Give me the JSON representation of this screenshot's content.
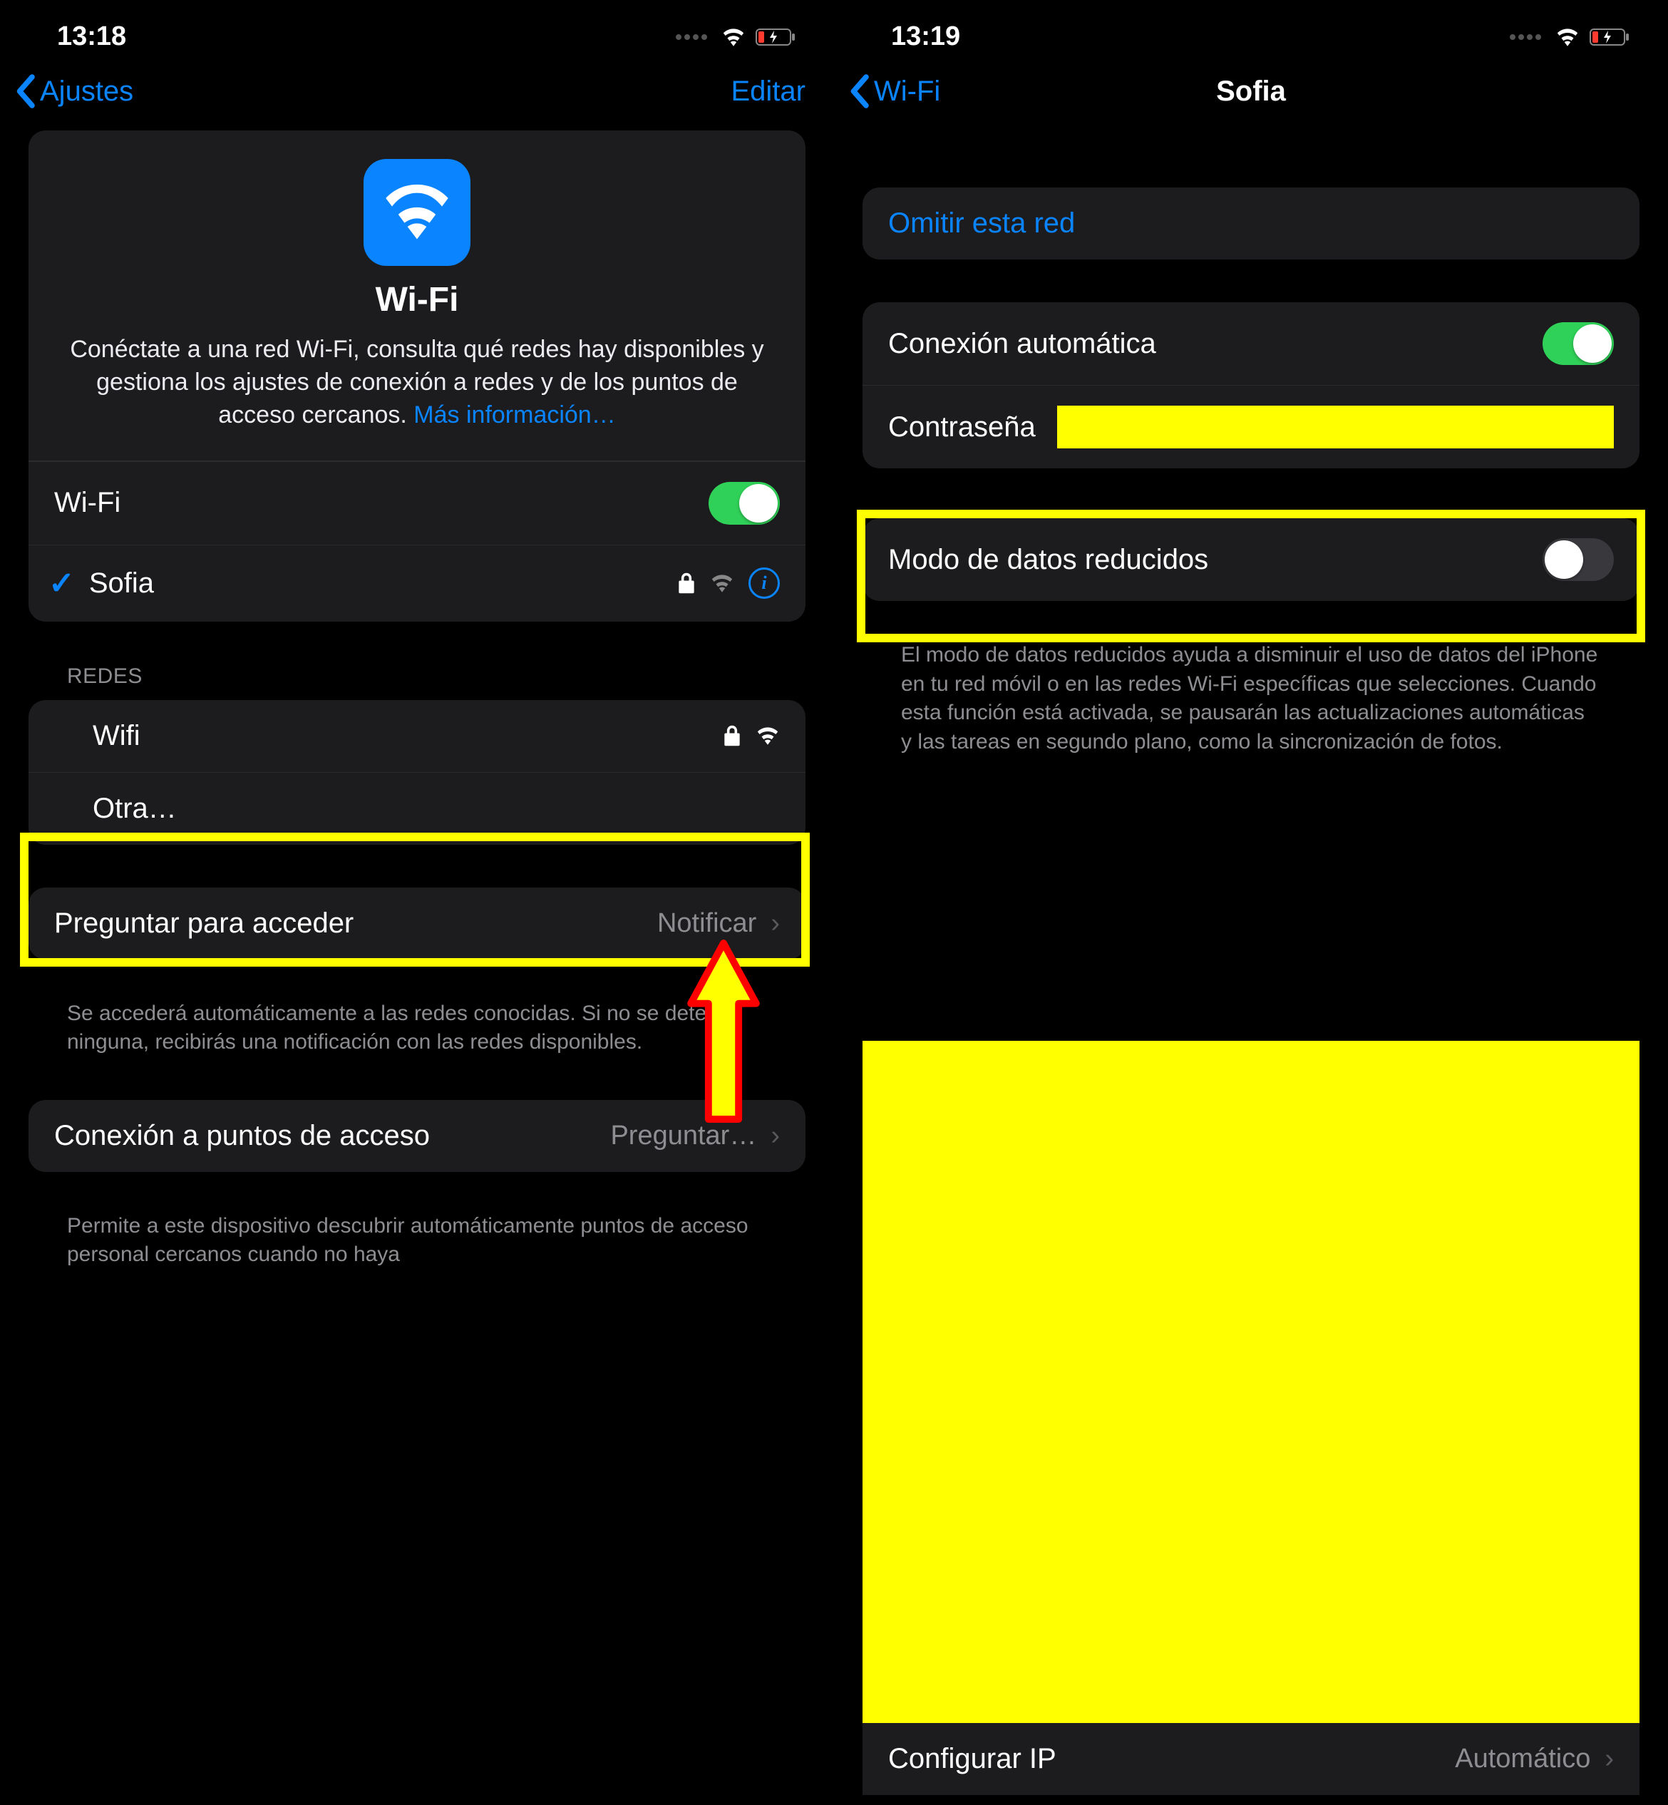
{
  "left": {
    "status": {
      "time": "13:18"
    },
    "nav": {
      "back": "Ajustes",
      "edit": "Editar"
    },
    "header": {
      "title": "Wi-Fi",
      "desc_pre": "Conéctate a una red Wi-Fi, consulta qué redes hay disponibles y gestiona los ajustes de conexión a redes y de los puntos de acceso cercanos. ",
      "more": "Más información…"
    },
    "wifi_toggle_label": "Wi-Fi",
    "connected_network": "Sofia",
    "networks_header": "REDES",
    "networks": [
      {
        "name": "Wifi"
      },
      {
        "name": "Otra…"
      }
    ],
    "ask_join": {
      "label": "Preguntar para acceder",
      "value": "Notificar"
    },
    "ask_join_note": "Se accederá automáticamente a las redes conocidas. Si no se detecta ninguna, recibirás una notificación con las redes disponibles.",
    "hotspot": {
      "label": "Conexión a puntos de acceso",
      "value": "Preguntar…"
    },
    "hotspot_note": "Permite a este dispositivo descubrir automáticamente puntos de acceso personal cercanos cuando no haya"
  },
  "right": {
    "status": {
      "time": "13:19"
    },
    "nav": {
      "back": "Wi-Fi",
      "title": "Sofia"
    },
    "omit": "Omitir esta red",
    "auto_join": "Conexión automática",
    "password_label": "Contraseña",
    "low_data": {
      "label": "Modo de datos reducidos"
    },
    "low_data_note": "El modo de datos reducidos ayuda a disminuir el uso de datos del iPhone en tu red móvil o en las redes Wi-Fi específicas que selecciones. Cuando esta función está activada, se pausarán las actualizaciones automáticas y las tareas en segundo plano, como la sincronización de fotos.",
    "configure_ip": {
      "label": "Configurar IP",
      "value": "Automático"
    }
  }
}
